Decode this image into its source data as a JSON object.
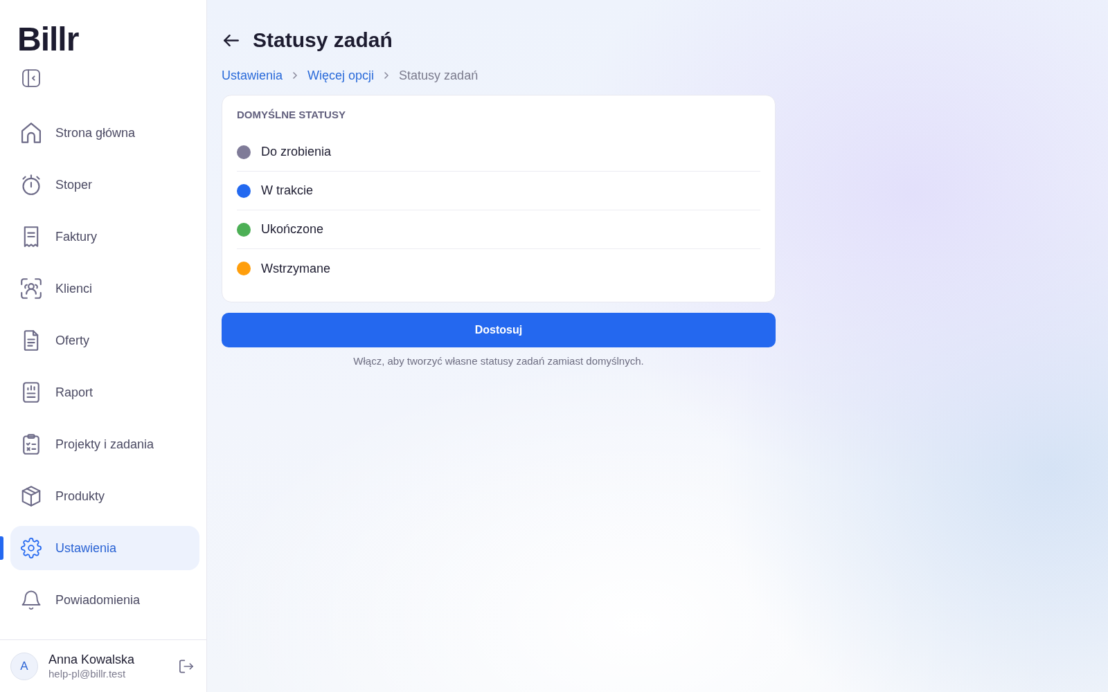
{
  "sidebar": {
    "logo": "Billr",
    "nav": [
      {
        "label": "Strona główna",
        "selected": false
      },
      {
        "label": "Stoper",
        "selected": false
      },
      {
        "label": "Faktury",
        "selected": false
      },
      {
        "label": "Klienci",
        "selected": false
      },
      {
        "label": "Oferty",
        "selected": false
      },
      {
        "label": "Raport",
        "selected": false
      },
      {
        "label": "Projekty i zadania",
        "selected": false
      },
      {
        "label": "Produkty",
        "selected": false
      },
      {
        "label": "Ustawienia",
        "selected": true
      },
      {
        "label": "Powiadomienia",
        "selected": false
      }
    ],
    "user": {
      "avatar": "A",
      "name": "Anna Kowalska",
      "email": "help-pl@billr.test"
    }
  },
  "page": {
    "title": "Statusy zadań",
    "breadcrumb": [
      {
        "label": "Ustawienia",
        "kind": "link"
      },
      {
        "label": "Więcej opcji",
        "kind": "link"
      },
      {
        "label": "Statusy zadań",
        "kind": "current"
      }
    ],
    "card": {
      "heading": "DOMYŚLNE STATUSY",
      "statuses": [
        {
          "label": "Do zrobienia",
          "color": "#7f7b98"
        },
        {
          "label": "W trakcie",
          "color": "#2369f0"
        },
        {
          "label": "Ukończone",
          "color": "#4caf55"
        },
        {
          "label": "Wstrzymane",
          "color": "#ff9e0b"
        }
      ]
    },
    "button": "Dostosuj",
    "hint": "Włącz, aby tworzyć własne statusy zadań zamiast domyślnych."
  }
}
